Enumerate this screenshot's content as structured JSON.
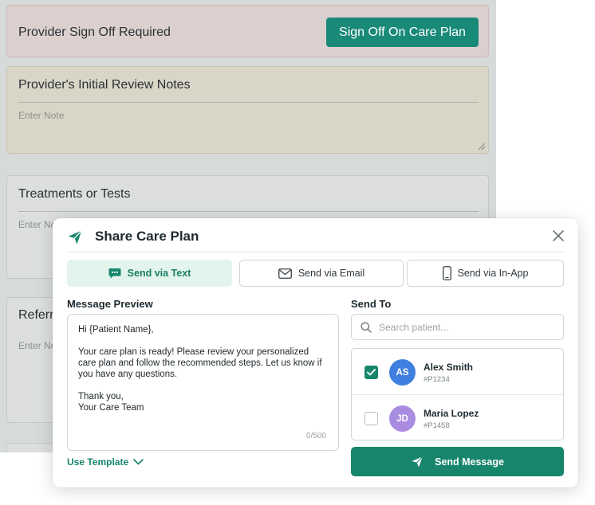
{
  "background": {
    "signoff": {
      "title": "Provider Sign Off Required",
      "button_label": "Sign Off On Care Plan"
    },
    "notes": {
      "title": "Provider's Initial Review Notes",
      "placeholder": "Enter Note"
    },
    "treatments": {
      "title": "Treatments or Tests",
      "placeholder": "Enter No"
    },
    "referrals": {
      "title": "Referr",
      "placeholder": "Enter No"
    }
  },
  "modal": {
    "title": "Share Care Plan",
    "tabs": [
      {
        "label": "Send via Text",
        "icon": "chat-bubble-icon",
        "active": true
      },
      {
        "label": "Send via Email",
        "icon": "envelope-icon",
        "active": false
      },
      {
        "label": "Send via In-App",
        "icon": "smartphone-icon",
        "active": false
      }
    ],
    "message_preview": {
      "label": "Message Preview",
      "greeting": "Hi {Patient Name},",
      "body": "Your care plan is ready! Please review your personalized care plan and follow the recommended steps. Let us know if you have any questions.",
      "closing_line1": "Thank you,",
      "closing_line2": "Your Care Team",
      "char_count": "0/500"
    },
    "use_template_label": "Use Template",
    "send_to": {
      "label": "Send To",
      "search_placeholder": "Search patient...",
      "patients": [
        {
          "initials": "AS",
          "name": "Alex Smith",
          "id": "#P1234",
          "checked": true,
          "avatar_color": "#3f7fe0"
        },
        {
          "initials": "JD",
          "name": "Maria Lopez",
          "id": "#P1458",
          "checked": false,
          "avatar_color": "#a98be0"
        }
      ]
    },
    "send_button_label": "Send Message"
  },
  "colors": {
    "accent": "#17866c",
    "accent_light": "#e3f4ec",
    "signoff_bg": "#dcd0cf",
    "notes_bg": "#d9d6c8"
  }
}
